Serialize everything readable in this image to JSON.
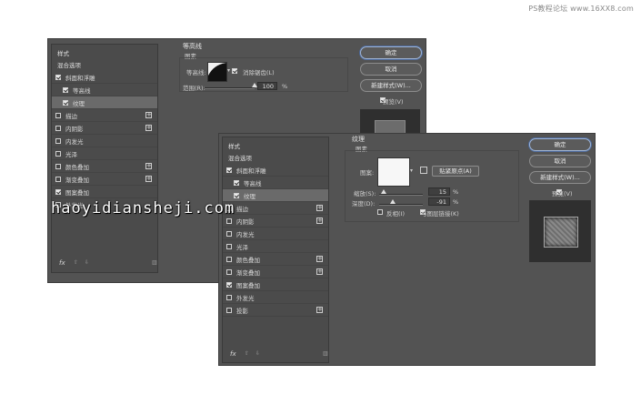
{
  "watermark": "PS教程论坛 www.16XX8.com",
  "site_mark": "haoyidiansheji.com",
  "dialog1": {
    "sidebar": {
      "header": "样式",
      "blend": "混合选项",
      "items": [
        {
          "label": "斜面和浮雕",
          "checked": true,
          "plus": false
        },
        {
          "label": "等高线",
          "checked": true,
          "plus": false
        },
        {
          "label": "纹理",
          "checked": true,
          "plus": false
        },
        {
          "label": "描边",
          "checked": false,
          "plus": true
        },
        {
          "label": "内阴影",
          "checked": false,
          "plus": true
        },
        {
          "label": "内发光",
          "checked": false,
          "plus": false
        },
        {
          "label": "光泽",
          "checked": false,
          "plus": false
        },
        {
          "label": "颜色叠加",
          "checked": false,
          "plus": true
        },
        {
          "label": "渐变叠加",
          "checked": false,
          "plus": true
        },
        {
          "label": "图案叠加",
          "checked": true,
          "plus": false
        },
        {
          "label": "外发光",
          "checked": false,
          "plus": false
        }
      ],
      "fx": "fx"
    },
    "section_title": "等高线",
    "section_sub": "图素",
    "contour_label": "等高线:",
    "anti_alias": "消除锯齿(L)",
    "range_label": "范围(R):",
    "range_value": "100",
    "percent": "%",
    "buttons": {
      "ok": "确定",
      "cancel": "取消",
      "new_style": "新建样式(W)...",
      "preview": "预览(V)"
    }
  },
  "dialog2": {
    "sidebar": {
      "header": "样式",
      "blend": "混合选项",
      "items": [
        {
          "label": "斜面和浮雕",
          "checked": true,
          "plus": false
        },
        {
          "label": "等高线",
          "checked": true,
          "plus": false
        },
        {
          "label": "纹理",
          "checked": true,
          "plus": false
        },
        {
          "label": "描边",
          "checked": false,
          "plus": true
        },
        {
          "label": "内阴影",
          "checked": false,
          "plus": true
        },
        {
          "label": "内发光",
          "checked": false,
          "plus": false
        },
        {
          "label": "光泽",
          "checked": false,
          "plus": false
        },
        {
          "label": "颜色叠加",
          "checked": false,
          "plus": true
        },
        {
          "label": "渐变叠加",
          "checked": false,
          "plus": true
        },
        {
          "label": "图案叠加",
          "checked": true,
          "plus": false
        },
        {
          "label": "外发光",
          "checked": false,
          "plus": false
        },
        {
          "label": "投影",
          "checked": false,
          "plus": true
        }
      ],
      "fx": "fx"
    },
    "section_title": "纹理",
    "section_sub": "图素",
    "pattern_label": "图案:",
    "snap_button": "贴紧原点(A)",
    "scale_label": "缩放(S):",
    "scale_value": "15",
    "depth_label": "深度(D):",
    "depth_value": "-91",
    "percent": "%",
    "invert": "反相(I)",
    "link_layer": "与图层链接(K)",
    "buttons": {
      "ok": "确定",
      "cancel": "取消",
      "new_style": "新建样式(W)...",
      "preview": "预览(V)"
    }
  }
}
